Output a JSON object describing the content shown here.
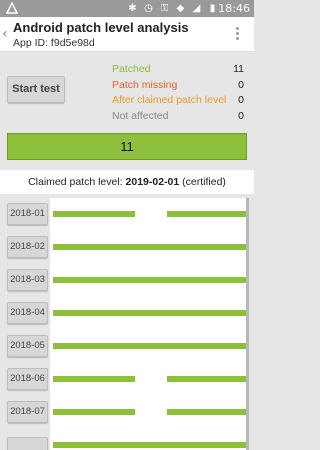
{
  "statusbar": {
    "time": "18:46"
  },
  "appbar": {
    "title": "Android patch level analysis",
    "app_id": "App ID: f9d5e98d"
  },
  "start_button": "Start test",
  "stats": [
    {
      "label": "Patched",
      "value": "11",
      "color": "#8dbb3a"
    },
    {
      "label": "Patch missing",
      "value": "0",
      "color": "#e0622e"
    },
    {
      "label": "After claimed patch level",
      "value": "0",
      "color": "#e89a2a"
    },
    {
      "label": "Not affected",
      "value": "0",
      "color": "#888888"
    }
  ],
  "summary_count": "11",
  "claimed": {
    "prefix": "Claimed patch level: ",
    "date": "2019-02-01",
    "suffix": " (certified)"
  },
  "months": [
    {
      "label": "2018-01",
      "patched_fraction": 1.0
    },
    {
      "label": "2018-02",
      "patched_fraction": 1.0
    },
    {
      "label": "2018-03",
      "patched_fraction": 1.0
    },
    {
      "label": "2018-04",
      "patched_fraction": 1.0
    },
    {
      "label": "2018-05",
      "patched_fraction": 1.0
    },
    {
      "label": "2018-06",
      "patched_fraction": 1.0
    },
    {
      "label": "2018-07",
      "patched_fraction": 1.0
    },
    {
      "label": "",
      "patched_fraction": 1.0
    }
  ]
}
